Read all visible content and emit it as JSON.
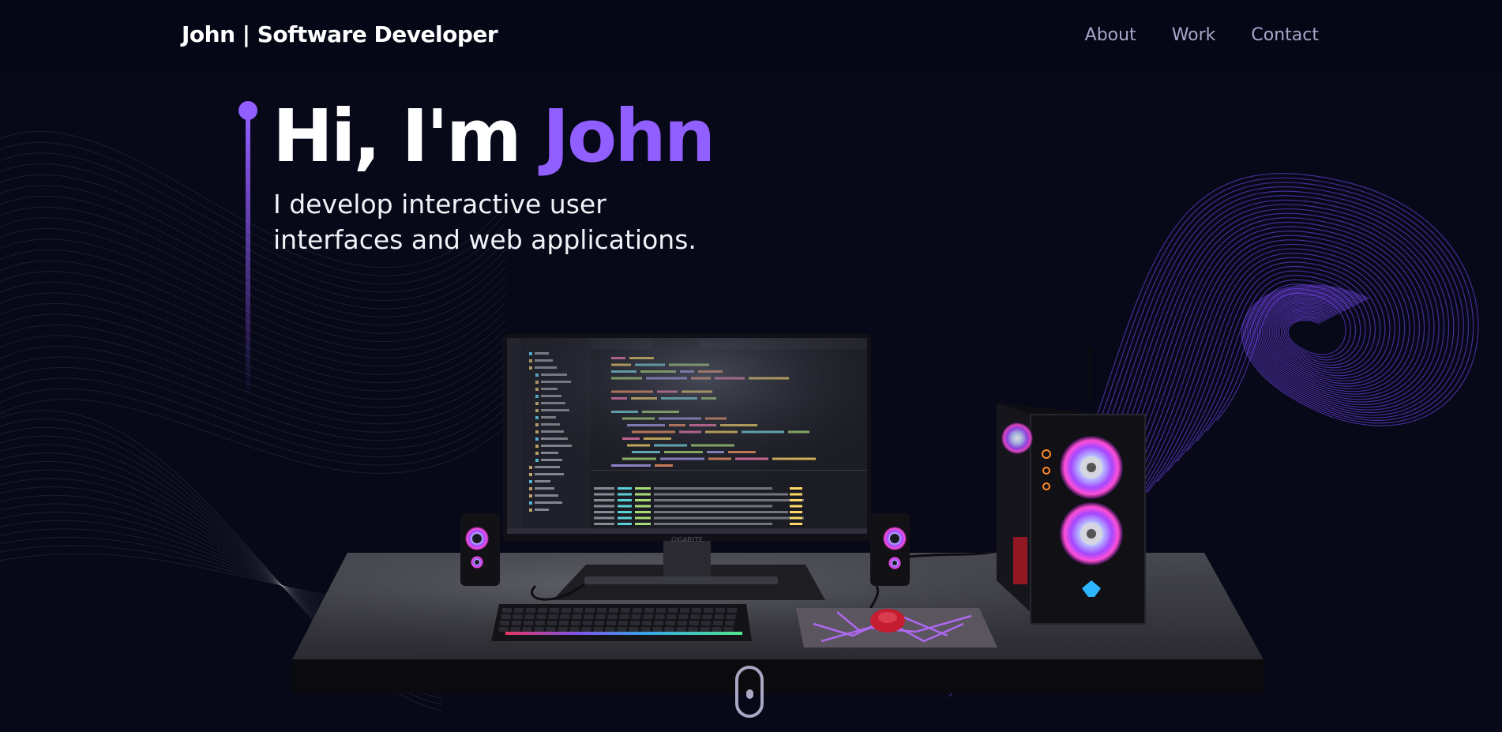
{
  "navbar": {
    "brand": "John | Software Developer",
    "links": [
      {
        "label": "About"
      },
      {
        "label": "Work"
      },
      {
        "label": "Contact"
      }
    ]
  },
  "hero": {
    "greeting": "Hi, I'm ",
    "name": "John",
    "subtitle_line1": "I develop interactive user",
    "subtitle_line2": "interfaces and web applications."
  },
  "monitor": {
    "brand": "GIGABYTE"
  },
  "colors": {
    "background": "#070818",
    "accent": "#915eff",
    "nav_text": "#a9a6c9"
  },
  "icons": [
    "scroll-down-icon"
  ]
}
